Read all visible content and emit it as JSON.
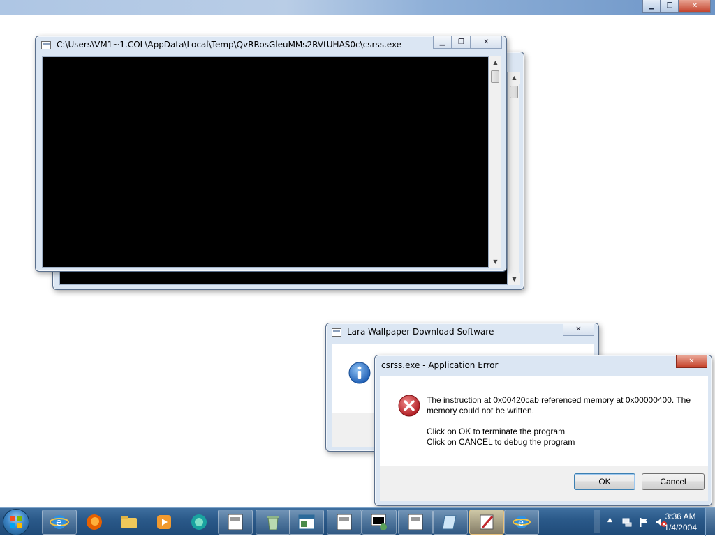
{
  "top_window": {
    "minimize": "▁",
    "restore": "❐",
    "close": "✕"
  },
  "console_window": {
    "title": "C:\\Users\\VM1~1.COL\\AppData\\Local\\Temp\\QvRRosGleuMMs2RVtUHAS0c\\csrss.exe",
    "minimize": "▁",
    "restore": "❐",
    "close": "✕",
    "scroll_up": "▲",
    "scroll_down": "▼"
  },
  "lara_dialog": {
    "title": "Lara Wallpaper Download Software",
    "close": "✕",
    "icon": "info-icon"
  },
  "error_dialog": {
    "title": "csrss.exe - Application Error",
    "close": "✕",
    "icon": "error-icon",
    "message_line1": "The instruction at 0x00420cab referenced memory at 0x00000400. The",
    "message_line2": "memory could not be written.",
    "instruction_line1": "Click on OK to terminate the program",
    "instruction_line2": "Click on CANCEL to debug the program",
    "ok_label": "OK",
    "cancel_label": "Cancel"
  },
  "taskbar": {
    "clock_time": "3:36 AM",
    "clock_date": "1/4/2004",
    "tray_expand": "▲"
  },
  "colors": {
    "taskbar": "#1f4a78",
    "error_red": "#c0272d",
    "info_blue": "#1f5fb5"
  }
}
